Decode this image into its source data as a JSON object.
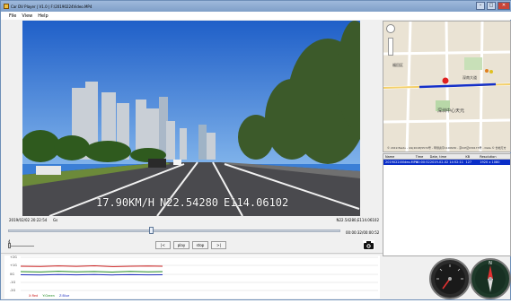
{
  "window": {
    "title": "Car DV Player | V1.0 | F:\\20190224Video.MP4"
  },
  "menu": [
    "File",
    "View",
    "Help"
  ],
  "video": {
    "speed": "17.90KM/H",
    "lat": "N22.54280",
    "lon": "E114.06102"
  },
  "status": {
    "datetime": "2019/02/02 20:22:54",
    "gsensor": "Gs",
    "coords": "N22.54280,E114.06102",
    "time": "00:00:32/00:00:52"
  },
  "controls": {
    "prev": "|<",
    "play": "play",
    "stop": "stop",
    "next": ">|",
    "volume_level": "4"
  },
  "chart": {
    "y_labels": [
      "+2G",
      "+1G",
      "0G",
      "-1G",
      "-2G"
    ],
    "legend": [
      "X:Red",
      "Y:Green",
      "Z:Blue"
    ]
  },
  "map": {
    "labels": [
      "深圳中心天元",
      "深南大道",
      "福田区"
    ],
    "footer": "© 2019 Baidu - GS(2018)5572号 - 甲测资字1100930 - 京ICP证030173号 - Data © 长地万方"
  },
  "table": {
    "headers": [
      "Name",
      "Time",
      "Date, time",
      "KB",
      "Resolution"
    ],
    "rows": [
      [
        "20190224Video.MP4",
        "00:00:52",
        "2019-02-02 14:52:11",
        "127",
        "1920 x 1080"
      ]
    ]
  },
  "colors": {
    "titlebar": "#8aa9d4",
    "selection": "#0a2ec8",
    "x_series": "#cc2020",
    "y_series": "#208a20",
    "z_series": "#2030c0"
  }
}
